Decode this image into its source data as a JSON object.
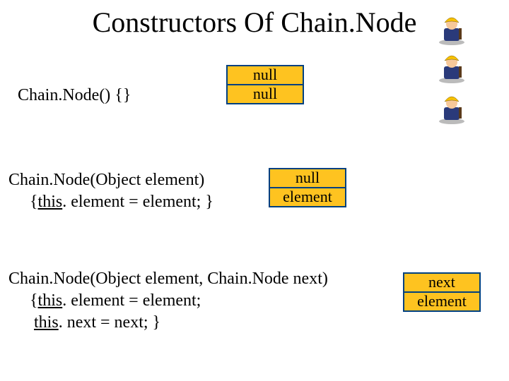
{
  "title": "Constructors Of Chain.Node",
  "sections": {
    "c1": {
      "code_line1": "Chain.Node() {}",
      "box_top": "null",
      "box_bot": "null"
    },
    "c2": {
      "code_line1": "Chain.Node(Object element)",
      "code_indent": "     {",
      "code_this": "this",
      "code_rest": ". element = element; }",
      "box_top": "null",
      "box_bot": "element"
    },
    "c3": {
      "code_line1": "Chain.Node(Object element, Chain.Node next)",
      "code_l2_indent": "     {",
      "code_l2_this": "this",
      "code_l2_rest": ". element = element;",
      "code_l3_indent": "      ",
      "code_l3_this": "this",
      "code_l3_rest": ". next = next; }",
      "box_top": "next",
      "box_bot": "element"
    }
  }
}
